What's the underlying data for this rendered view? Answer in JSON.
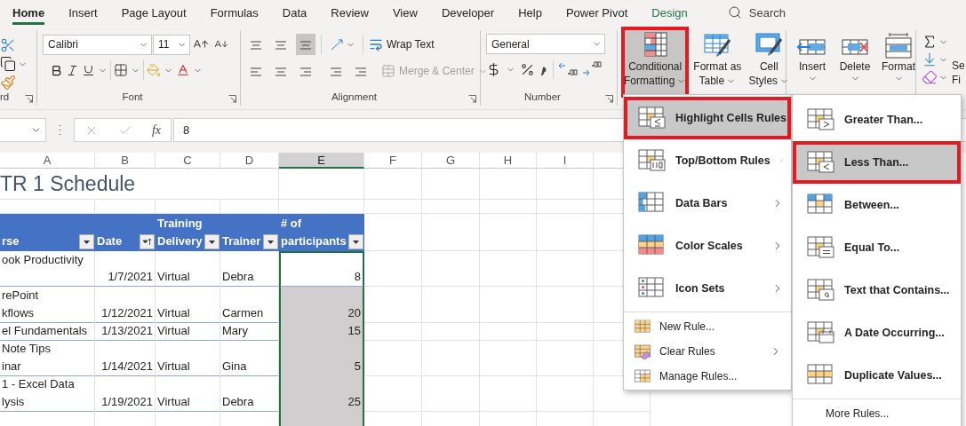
{
  "tabs": [
    {
      "label": "Home",
      "selected": true,
      "kind": "normal"
    },
    {
      "label": "Insert",
      "selected": false,
      "kind": "normal"
    },
    {
      "label": "Page Layout",
      "selected": false,
      "kind": "normal"
    },
    {
      "label": "Formulas",
      "selected": false,
      "kind": "normal"
    },
    {
      "label": "Data",
      "selected": false,
      "kind": "normal"
    },
    {
      "label": "Review",
      "selected": false,
      "kind": "normal"
    },
    {
      "label": "View",
      "selected": false,
      "kind": "normal"
    },
    {
      "label": "Developer",
      "selected": false,
      "kind": "normal"
    },
    {
      "label": "Help",
      "selected": false,
      "kind": "normal"
    },
    {
      "label": "Power Pivot",
      "selected": false,
      "kind": "normal"
    },
    {
      "label": "Design",
      "selected": false,
      "kind": "contextual"
    }
  ],
  "search": {
    "placeholder": "Search"
  },
  "ribbon": {
    "clipboard": {
      "label": "rd"
    },
    "font": {
      "label": "Font",
      "name": "Calibri",
      "size": "11"
    },
    "alignment": {
      "label": "Alignment",
      "vertical_align": [
        {
          "selected": false
        },
        {
          "selected": false
        },
        {
          "selected": true
        }
      ],
      "wrap_text": "Wrap Text",
      "merge": {
        "label": "Merge & Center",
        "disabled": true
      }
    },
    "number": {
      "label": "Number",
      "format": "General"
    },
    "styles": [
      {
        "lines": [
          "Conditional",
          "Formatting"
        ],
        "selected": true,
        "outlined": true
      },
      {
        "lines": [
          "Format as",
          "Table"
        ],
        "selected": false,
        "outlined": false
      },
      {
        "lines": [
          "Cell",
          "Styles"
        ],
        "selected": false,
        "outlined": false
      }
    ],
    "cells": [
      {
        "label": "Insert"
      },
      {
        "label": "Delete"
      },
      {
        "label": "Format"
      }
    ],
    "editing": {
      "lines": [
        "Se",
        "Fi"
      ]
    }
  },
  "formula_bar": {
    "function_label": "fx",
    "value": "8"
  },
  "sheet": {
    "columns": [
      {
        "label": "A",
        "selected": false
      },
      {
        "label": "B",
        "selected": false
      },
      {
        "label": "C",
        "selected": false
      },
      {
        "label": "D",
        "selected": false
      },
      {
        "label": "E",
        "selected": true
      },
      {
        "label": "F",
        "selected": false
      },
      {
        "label": "G",
        "selected": false
      },
      {
        "label": "H",
        "selected": false
      },
      {
        "label": "I",
        "selected": false
      }
    ],
    "title": "TR 1 Schedule",
    "table": {
      "headers": [
        {
          "lines": [
            "rse"
          ],
          "kind": "filter"
        },
        {
          "lines": [
            "Date"
          ],
          "kind": "sorted"
        },
        {
          "lines": [
            "Training",
            "Delivery"
          ],
          "kind": "filter"
        },
        {
          "lines": [
            "Trainer"
          ],
          "kind": "filter"
        },
        {
          "lines": [
            "# of",
            "participants"
          ],
          "kind": "filter"
        }
      ],
      "rows": [
        {
          "kind": "data",
          "course": [
            "ook Productivity"
          ],
          "date": "1/7/2021",
          "delivery": "Virtual",
          "trainer": "Debra",
          "participants": "8",
          "selected": true,
          "active": true
        },
        {
          "kind": "data",
          "course": [
            "rePoint",
            "kflows"
          ],
          "date": "1/12/2021",
          "delivery": "Virtual",
          "trainer": "Carmen",
          "participants": "20",
          "selected": true,
          "active": false
        },
        {
          "kind": "data",
          "course": [
            "el Fundamentals"
          ],
          "date": "1/13/2021",
          "delivery": "Virtual",
          "trainer": "Mary",
          "participants": "15",
          "selected": true,
          "active": false
        },
        {
          "kind": "data",
          "course": [
            "Note Tips",
            "inar"
          ],
          "date": "1/14/2021",
          "delivery": "Virtual",
          "trainer": "Gina",
          "participants": "5",
          "selected": true,
          "active": false
        },
        {
          "kind": "data",
          "course": [
            "1 - Excel Data",
            "lysis"
          ],
          "date": "1/19/2021",
          "delivery": "Virtual",
          "trainer": "Debra",
          "participants": "25",
          "selected": true,
          "active": false
        },
        {
          "kind": "blank",
          "selected": true,
          "active": false
        }
      ]
    }
  },
  "conditional_menu": {
    "items": [
      {
        "label": "Highlight Cells Rules",
        "kind": "large",
        "submenu": true,
        "selected": true,
        "outlined": true
      },
      {
        "label": "Top/Bottom Rules",
        "kind": "large",
        "submenu": true,
        "selected": false,
        "outlined": false
      },
      {
        "label": "Data Bars",
        "kind": "large",
        "submenu": true,
        "selected": false,
        "outlined": false
      },
      {
        "label": "Color Scales",
        "kind": "large",
        "submenu": true,
        "selected": false,
        "outlined": false
      },
      {
        "label": "Icon Sets",
        "kind": "large",
        "submenu": true,
        "selected": false,
        "outlined": false
      },
      {
        "label": "New Rule...",
        "kind": "small",
        "submenu": false,
        "selected": false,
        "outlined": false
      },
      {
        "label": "Clear Rules",
        "kind": "small",
        "submenu": true,
        "selected": false,
        "outlined": false
      },
      {
        "label": "Manage Rules...",
        "kind": "small",
        "submenu": false,
        "selected": false,
        "outlined": false
      }
    ]
  },
  "highlight_submenu": {
    "items": [
      {
        "label": "Greater Than...",
        "kind": "large",
        "selected": false,
        "outlined": false
      },
      {
        "label": "Less Than...",
        "kind": "large",
        "selected": true,
        "outlined": true
      },
      {
        "label": "Between...",
        "kind": "large",
        "selected": false,
        "outlined": false
      },
      {
        "label": "Equal To...",
        "kind": "large",
        "selected": false,
        "outlined": false
      },
      {
        "label": "Text that Contains...",
        "kind": "large",
        "selected": false,
        "outlined": false
      },
      {
        "label": "A Date Occurring...",
        "kind": "large",
        "selected": false,
        "outlined": false
      },
      {
        "label": "Duplicate Values...",
        "kind": "large",
        "selected": false,
        "outlined": false
      },
      {
        "label": "More Rules...",
        "kind": "plain",
        "selected": false,
        "outlined": false
      }
    ]
  }
}
